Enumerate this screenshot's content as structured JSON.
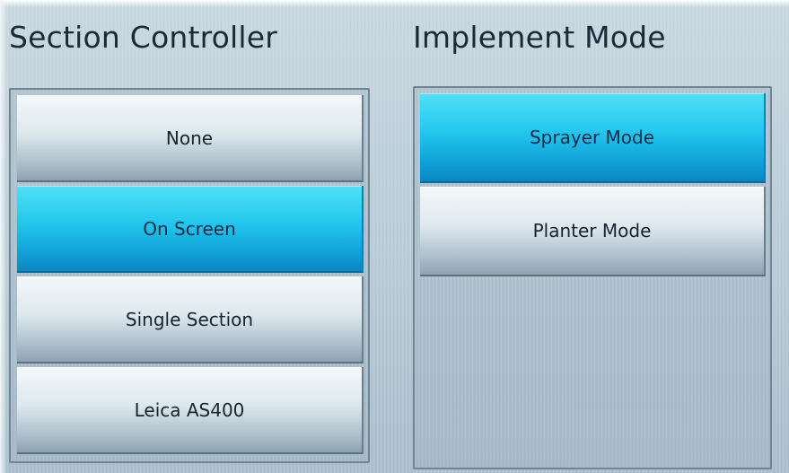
{
  "section_controller": {
    "title": "Section Controller",
    "options": [
      {
        "label": "None",
        "selected": false
      },
      {
        "label": "On Screen",
        "selected": true
      },
      {
        "label": "Single Section",
        "selected": false
      },
      {
        "label": "Leica AS400",
        "selected": false
      }
    ]
  },
  "implement_mode": {
    "title": "Implement Mode",
    "options": [
      {
        "label": "Sprayer Mode",
        "selected": true
      },
      {
        "label": "Planter Mode",
        "selected": false
      }
    ]
  },
  "colors": {
    "selected": "#22c6ec",
    "unselected": "#dde8ee",
    "background": "#b9ccd7"
  }
}
